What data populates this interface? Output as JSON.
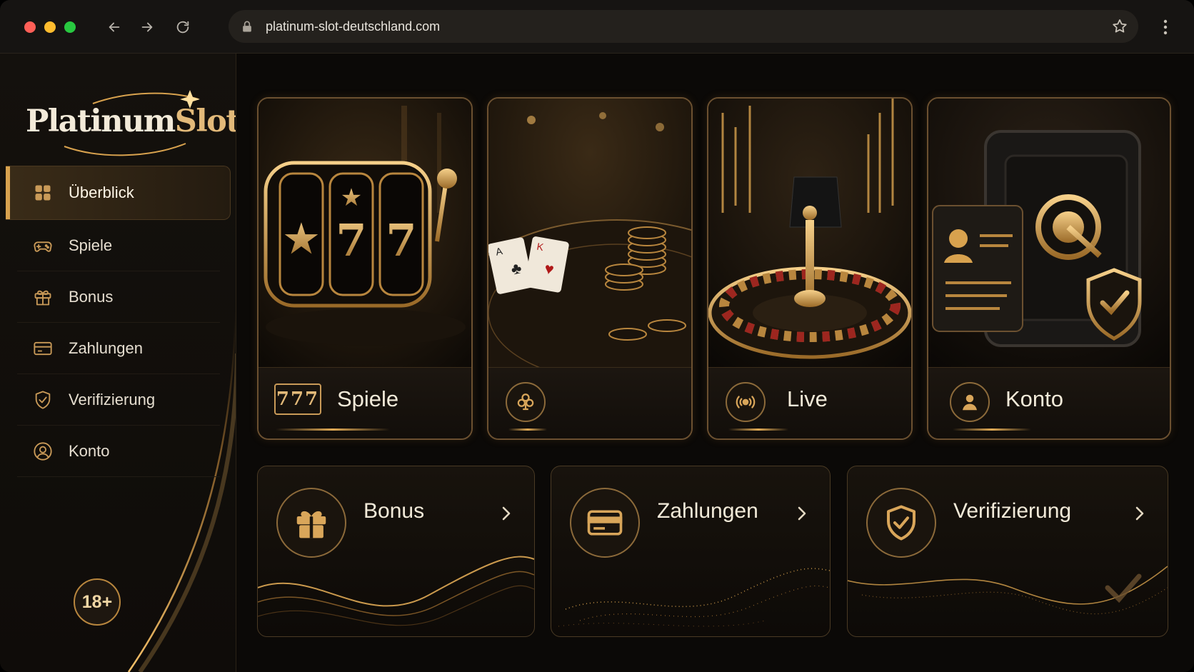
{
  "browser": {
    "url": "platinum-slot-deutschland.com"
  },
  "brand": {
    "logo_main": "Platinum",
    "logo_accent": "Slots",
    "age_badge": "18+"
  },
  "sidebar": {
    "items": [
      {
        "label": "Überblick",
        "icon": "grid-icon",
        "active": true
      },
      {
        "label": "Spiele",
        "icon": "gamepad-icon"
      },
      {
        "label": "Bonus",
        "icon": "gift-icon"
      },
      {
        "label": "Zahlungen",
        "icon": "card-icon"
      },
      {
        "label": "Verifizierung",
        "icon": "shield-check-icon"
      },
      {
        "label": "Konto",
        "icon": "user-icon"
      }
    ]
  },
  "cards": [
    {
      "label": "Spiele",
      "icon": "slot-777-icon",
      "art": "slot-machine"
    },
    {
      "label": "",
      "icon": "club-icon",
      "art": "card-table"
    },
    {
      "label": "Live",
      "icon": "broadcast-icon",
      "art": "roulette"
    },
    {
      "label": "Konto",
      "icon": "user-icon",
      "art": "safe"
    }
  ],
  "tiles": [
    {
      "label": "Bonus",
      "icon": "gift-icon"
    },
    {
      "label": "Zahlungen",
      "icon": "card-icon"
    },
    {
      "label": "Verifizierung",
      "icon": "shield-check-icon"
    }
  ],
  "colors": {
    "accent": "#d8a24e",
    "background": "#0b0907"
  }
}
